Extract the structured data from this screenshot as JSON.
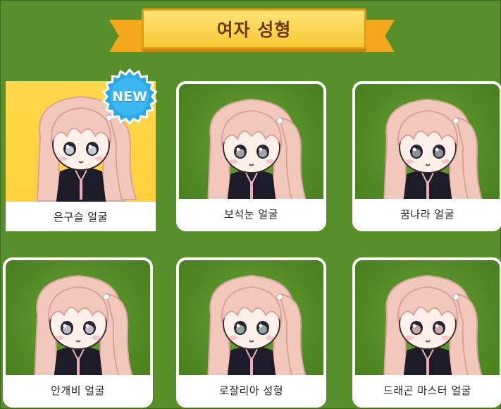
{
  "header": {
    "title": "여자 성형"
  },
  "badge": {
    "label": "NEW"
  },
  "items": [
    {
      "label": "은구슬 얼굴",
      "selected": true,
      "eye": "#c8ccd6"
    },
    {
      "label": "보석눈 얼굴",
      "selected": false,
      "eye": "#9aa6a8"
    },
    {
      "label": "꿈나라 얼굴",
      "selected": false,
      "eye": "#8c8f98"
    },
    {
      "label": "안개비 얼굴",
      "selected": false,
      "eye": "#b9bec8"
    },
    {
      "label": "로잘리아 성형",
      "selected": false,
      "eye": "#8da59a"
    },
    {
      "label": "드래곤 마스터 얼굴",
      "selected": false,
      "eye": "#c9a7a5"
    }
  ],
  "colors": {
    "background": "#57902a",
    "selected_card": "#ffd74a",
    "ribbon": "#f8c833",
    "hair": "#f2c7bc",
    "outfit": "#1e1c28",
    "badge": "#2aa8e8"
  }
}
